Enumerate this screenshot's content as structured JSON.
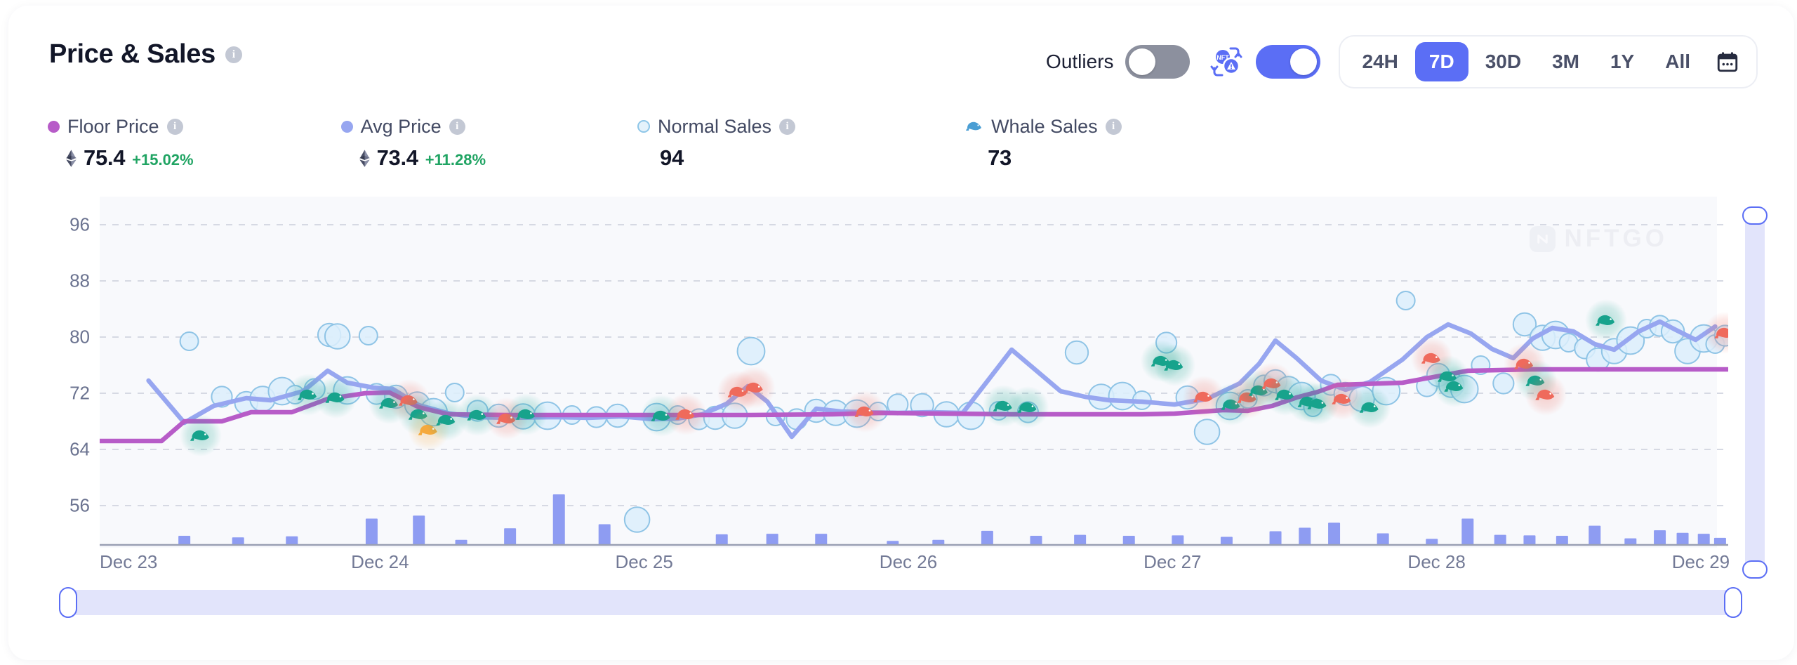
{
  "header": {
    "title": "Price & Sales",
    "info_icon": "info-icon"
  },
  "controls": {
    "outliers_label": "Outliers",
    "outliers_state": "off",
    "wash_trade_icon": "nft-wash-trade-filter-icon",
    "wash_trade_state": "on",
    "calendar_icon": "calendar-icon",
    "ranges": [
      {
        "label": "24H",
        "active": false
      },
      {
        "label": "7D",
        "active": true
      },
      {
        "label": "30D",
        "active": false
      },
      {
        "label": "3M",
        "active": false
      },
      {
        "label": "1Y",
        "active": false
      },
      {
        "label": "All",
        "active": false
      }
    ]
  },
  "legend": [
    {
      "name": "Floor Price",
      "marker": "dot-filled",
      "color": "#b75cc8",
      "eth": true,
      "value": "75.4",
      "change": "+15.02%"
    },
    {
      "name": "Avg Price",
      "marker": "dot-filled",
      "color": "#97a6f0",
      "eth": true,
      "value": "73.4",
      "change": "+11.28%"
    },
    {
      "name": "Normal Sales",
      "marker": "dot-hollow",
      "color": "#8ec6e8",
      "eth": false,
      "value": "94",
      "change": ""
    },
    {
      "name": "Whale Sales",
      "marker": "whale-icon",
      "color": "#4a9ed4",
      "eth": false,
      "value": "73",
      "change": ""
    }
  ],
  "watermark": {
    "text": "NFTGO"
  },
  "chart_data": {
    "type": "scatter",
    "title": "Price & Sales",
    "xlabel": "",
    "ylabel": "",
    "ylim": [
      50,
      100
    ],
    "yticks": [
      96,
      88,
      80,
      72,
      64,
      56
    ],
    "xticks": [
      "Dec 23",
      "Dec 24",
      "Dec 25",
      "Dec 26",
      "Dec 27",
      "Dec 28",
      "Dec 29"
    ],
    "grid": "horizontal-dashed",
    "legend_position": "top-left",
    "series": [
      {
        "name": "Floor Price",
        "type": "line",
        "color": "#b75cc8",
        "points": [
          [
            0.0,
            65.2
          ],
          [
            0.038,
            65.2
          ],
          [
            0.052,
            68.0
          ],
          [
            0.075,
            68.0
          ],
          [
            0.093,
            69.3
          ],
          [
            0.118,
            69.3
          ],
          [
            0.14,
            71.2
          ],
          [
            0.163,
            72.0
          ],
          [
            0.178,
            72.1
          ],
          [
            0.196,
            70.0
          ],
          [
            0.214,
            69.0
          ],
          [
            0.25,
            68.9
          ],
          [
            0.3,
            68.9
          ],
          [
            0.35,
            68.9
          ],
          [
            0.4,
            68.9
          ],
          [
            0.45,
            69.0
          ],
          [
            0.48,
            69.2
          ],
          [
            0.52,
            69.1
          ],
          [
            0.56,
            69.0
          ],
          [
            0.6,
            69.0
          ],
          [
            0.64,
            69.0
          ],
          [
            0.66,
            69.1
          ],
          [
            0.69,
            69.6
          ],
          [
            0.705,
            69.5
          ],
          [
            0.72,
            70.2
          ],
          [
            0.735,
            71.4
          ],
          [
            0.748,
            72.2
          ],
          [
            0.76,
            73.2
          ],
          [
            0.775,
            73.3
          ],
          [
            0.8,
            73.5
          ],
          [
            0.84,
            75.2
          ],
          [
            0.88,
            75.4
          ],
          [
            0.93,
            75.4
          ],
          [
            1.0,
            75.4
          ]
        ]
      },
      {
        "name": "Avg Price",
        "type": "line",
        "color": "#97a6f0",
        "points": [
          [
            0.03,
            73.8
          ],
          [
            0.052,
            67.8
          ],
          [
            0.07,
            70.2
          ],
          [
            0.09,
            71.3
          ],
          [
            0.105,
            71.0
          ],
          [
            0.125,
            72.3
          ],
          [
            0.14,
            75.2
          ],
          [
            0.152,
            73.5
          ],
          [
            0.168,
            72.8
          ],
          [
            0.18,
            72.6
          ],
          [
            0.196,
            70.3
          ],
          [
            0.215,
            69.1
          ],
          [
            0.232,
            68.6
          ],
          [
            0.25,
            68.5
          ],
          [
            0.28,
            68.6
          ],
          [
            0.3,
            68.5
          ],
          [
            0.32,
            68.7
          ],
          [
            0.34,
            68.3
          ],
          [
            0.355,
            68.4
          ],
          [
            0.37,
            69.0
          ],
          [
            0.385,
            70.5
          ],
          [
            0.398,
            73.0
          ],
          [
            0.41,
            70.8
          ],
          [
            0.425,
            65.8
          ],
          [
            0.44,
            69.8
          ],
          [
            0.455,
            69.4
          ],
          [
            0.47,
            69.3
          ],
          [
            0.49,
            69.2
          ],
          [
            0.51,
            69.3
          ],
          [
            0.53,
            69.2
          ],
          [
            0.56,
            78.2
          ],
          [
            0.59,
            72.3
          ],
          [
            0.605,
            71.5
          ],
          [
            0.62,
            71.0
          ],
          [
            0.64,
            70.8
          ],
          [
            0.66,
            70.4
          ],
          [
            0.68,
            71.2
          ],
          [
            0.7,
            73.4
          ],
          [
            0.712,
            76.2
          ],
          [
            0.722,
            79.5
          ],
          [
            0.735,
            77.0
          ],
          [
            0.75,
            73.8
          ],
          [
            0.765,
            72.5
          ],
          [
            0.78,
            73.6
          ],
          [
            0.8,
            76.8
          ],
          [
            0.815,
            80.0
          ],
          [
            0.828,
            81.8
          ],
          [
            0.842,
            80.5
          ],
          [
            0.855,
            78.3
          ],
          [
            0.868,
            77.0
          ],
          [
            0.88,
            79.8
          ],
          [
            0.892,
            81.3
          ],
          [
            0.905,
            80.8
          ],
          [
            0.918,
            79.0
          ],
          [
            0.93,
            78.2
          ],
          [
            0.945,
            80.8
          ],
          [
            0.958,
            82.2
          ],
          [
            0.968,
            81.0
          ],
          [
            0.98,
            79.6
          ],
          [
            0.992,
            81.5
          ]
        ]
      },
      {
        "name": "Normal Sales",
        "type": "scatter",
        "color": "#bfdff5",
        "points": [
          [
            0.055,
            79.4
          ],
          [
            0.075,
            71.5
          ],
          [
            0.09,
            70.6
          ],
          [
            0.1,
            71.2
          ],
          [
            0.112,
            72.3
          ],
          [
            0.12,
            71.8
          ],
          [
            0.132,
            72.6
          ],
          [
            0.141,
            80.3
          ],
          [
            0.146,
            80.1
          ],
          [
            0.152,
            72.4
          ],
          [
            0.165,
            80.2
          ],
          [
            0.17,
            71.9
          ],
          [
            0.182,
            71.5
          ],
          [
            0.195,
            70.4
          ],
          [
            0.205,
            69.3
          ],
          [
            0.218,
            72.1
          ],
          [
            0.232,
            69.5
          ],
          [
            0.245,
            68.8
          ],
          [
            0.26,
            68.7
          ],
          [
            0.275,
            68.8
          ],
          [
            0.29,
            68.9
          ],
          [
            0.305,
            68.6
          ],
          [
            0.318,
            68.8
          ],
          [
            0.33,
            54.0
          ],
          [
            0.342,
            68.6
          ],
          [
            0.355,
            68.9
          ],
          [
            0.368,
            68.3
          ],
          [
            0.378,
            68.5
          ],
          [
            0.39,
            68.8
          ],
          [
            0.4,
            78.0
          ],
          [
            0.415,
            68.7
          ],
          [
            0.428,
            68.3
          ],
          [
            0.44,
            69.5
          ],
          [
            0.452,
            69.2
          ],
          [
            0.465,
            69.1
          ],
          [
            0.478,
            69.4
          ],
          [
            0.49,
            70.4
          ],
          [
            0.505,
            70.3
          ],
          [
            0.52,
            69.0
          ],
          [
            0.535,
            68.8
          ],
          [
            0.552,
            69.5
          ],
          [
            0.57,
            69.3
          ],
          [
            0.6,
            77.8
          ],
          [
            0.615,
            71.5
          ],
          [
            0.628,
            71.6
          ],
          [
            0.64,
            71.0
          ],
          [
            0.655,
            79.2
          ],
          [
            0.668,
            71.4
          ],
          [
            0.68,
            66.5
          ],
          [
            0.694,
            70.2
          ],
          [
            0.705,
            71.2
          ],
          [
            0.715,
            73.1
          ],
          [
            0.722,
            73.7
          ],
          [
            0.73,
            72.6
          ],
          [
            0.738,
            71.6
          ],
          [
            0.745,
            70.0
          ],
          [
            0.756,
            73.2
          ],
          [
            0.765,
            71.9
          ],
          [
            0.775,
            71.2
          ],
          [
            0.79,
            72.3
          ],
          [
            0.802,
            85.2
          ],
          [
            0.815,
            73.0
          ],
          [
            0.822,
            74.6
          ],
          [
            0.83,
            73.2
          ],
          [
            0.838,
            72.6
          ],
          [
            0.848,
            76.0
          ],
          [
            0.862,
            73.4
          ],
          [
            0.875,
            81.8
          ],
          [
            0.886,
            79.9
          ],
          [
            0.894,
            80.3
          ],
          [
            0.902,
            79.2
          ],
          [
            0.912,
            78.4
          ],
          [
            0.92,
            76.8
          ],
          [
            0.93,
            78.0
          ],
          [
            0.94,
            79.5
          ],
          [
            0.95,
            81.2
          ],
          [
            0.958,
            81.6
          ],
          [
            0.966,
            80.8
          ],
          [
            0.975,
            78.0
          ],
          [
            0.985,
            79.8
          ],
          [
            0.992,
            79.0
          ],
          [
            0.998,
            80.2
          ]
        ]
      },
      {
        "name": "Whale Sales",
        "type": "scatter-glyph",
        "glyph": "whale",
        "colors": {
          "teal": "#17a38c",
          "red": "#ef6a5c",
          "orange": "#f5a93c"
        },
        "points": [
          [
            0.062,
            66.0,
            "teal"
          ],
          [
            0.128,
            71.8,
            "teal"
          ],
          [
            0.145,
            71.4,
            "teal"
          ],
          [
            0.178,
            70.6,
            "teal"
          ],
          [
            0.19,
            71.0,
            "red"
          ],
          [
            0.196,
            69.0,
            "teal"
          ],
          [
            0.202,
            66.8,
            "orange"
          ],
          [
            0.213,
            68.2,
            "teal"
          ],
          [
            0.232,
            68.9,
            "teal"
          ],
          [
            0.25,
            68.4,
            "red"
          ],
          [
            0.262,
            69.0,
            "teal"
          ],
          [
            0.345,
            68.8,
            "teal"
          ],
          [
            0.36,
            69.0,
            "red"
          ],
          [
            0.392,
            72.2,
            "red"
          ],
          [
            0.402,
            72.8,
            "red"
          ],
          [
            0.47,
            69.4,
            "red"
          ],
          [
            0.555,
            70.2,
            "teal"
          ],
          [
            0.57,
            70.0,
            "teal"
          ],
          [
            0.652,
            76.6,
            "teal"
          ],
          [
            0.66,
            76.0,
            "teal"
          ],
          [
            0.678,
            71.5,
            "red"
          ],
          [
            0.695,
            70.4,
            "teal"
          ],
          [
            0.705,
            71.4,
            "red"
          ],
          [
            0.712,
            72.4,
            "teal"
          ],
          [
            0.72,
            73.4,
            "red"
          ],
          [
            0.728,
            71.8,
            "teal"
          ],
          [
            0.742,
            70.8,
            "teal"
          ],
          [
            0.748,
            70.5,
            "teal"
          ],
          [
            0.763,
            71.2,
            "red"
          ],
          [
            0.78,
            70.0,
            "teal"
          ],
          [
            0.818,
            77.0,
            "red"
          ],
          [
            0.828,
            74.4,
            "teal"
          ],
          [
            0.832,
            73.0,
            "teal"
          ],
          [
            0.875,
            76.2,
            "red"
          ],
          [
            0.882,
            73.8,
            "teal"
          ],
          [
            0.888,
            71.8,
            "red"
          ],
          [
            0.925,
            82.4,
            "teal"
          ],
          [
            0.998,
            80.6,
            "red"
          ]
        ]
      },
      {
        "name": "Volume",
        "type": "bar",
        "color": "#8e9cf2",
        "values": [
          [
            0.052,
            0.18
          ],
          [
            0.085,
            0.15
          ],
          [
            0.118,
            0.17
          ],
          [
            0.167,
            0.52
          ],
          [
            0.196,
            0.58
          ],
          [
            0.222,
            0.1
          ],
          [
            0.252,
            0.33
          ],
          [
            0.282,
            1.0
          ],
          [
            0.31,
            0.41
          ],
          [
            0.382,
            0.21
          ],
          [
            0.413,
            0.22
          ],
          [
            0.443,
            0.22
          ],
          [
            0.487,
            0.08
          ],
          [
            0.515,
            0.1
          ],
          [
            0.545,
            0.28
          ],
          [
            0.575,
            0.18
          ],
          [
            0.602,
            0.2
          ],
          [
            0.632,
            0.18
          ],
          [
            0.662,
            0.19
          ],
          [
            0.692,
            0.16
          ],
          [
            0.722,
            0.27
          ],
          [
            0.74,
            0.34
          ],
          [
            0.758,
            0.44
          ],
          [
            0.788,
            0.23
          ],
          [
            0.818,
            0.12
          ],
          [
            0.84,
            0.52
          ],
          [
            0.86,
            0.2
          ],
          [
            0.878,
            0.19
          ],
          [
            0.898,
            0.18
          ],
          [
            0.918,
            0.38
          ],
          [
            0.94,
            0.13
          ],
          [
            0.958,
            0.29
          ],
          [
            0.972,
            0.24
          ],
          [
            0.985,
            0.22
          ],
          [
            0.995,
            0.14
          ]
        ]
      }
    ]
  }
}
